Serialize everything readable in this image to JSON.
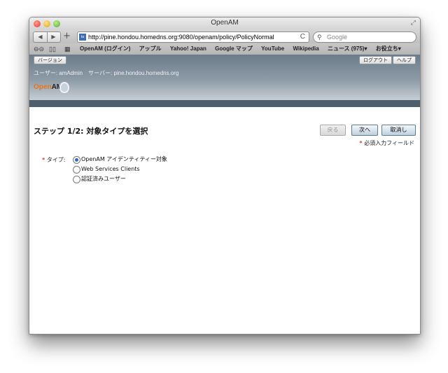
{
  "window": {
    "title": "OpenAM"
  },
  "browser": {
    "back_icon": "◀",
    "forward_icon": "▶",
    "add_icon": "+",
    "url": "http://pine.hondou.homedns.org:9080/openam/policy/PolicyNormal",
    "reload_icon": "C",
    "search_placeholder": "Google",
    "bookmarks": [
      "OpenAM (ログイン)",
      "アップル",
      "Yahoo! Japan",
      "Google マップ",
      "YouTube",
      "Wikipedia",
      "ニュース (975)▾",
      "お役立ち▾"
    ]
  },
  "header": {
    "version_button": "バージョン",
    "logout_button": "ログアウト",
    "help_button": "ヘルプ",
    "user_text": "ユーザー: amAdmin",
    "server_text": "サーバー: pine.hondou.homedns.org",
    "logo_open": "Open",
    "logo_am": "AM"
  },
  "page": {
    "title": "ステップ 1/2: 対象タイプを選択",
    "back_button": "戻る",
    "next_button": "次へ",
    "cancel_button": "取消し",
    "required_note": "必須入力フィールド",
    "required_star": "*",
    "type_label": "タイプ:",
    "options": [
      {
        "label": "OpenAM アイデンティティー対象",
        "selected": true
      },
      {
        "label": "Web Services Clients",
        "selected": false
      },
      {
        "label": "認証済みユーザー",
        "selected": false
      }
    ]
  }
}
